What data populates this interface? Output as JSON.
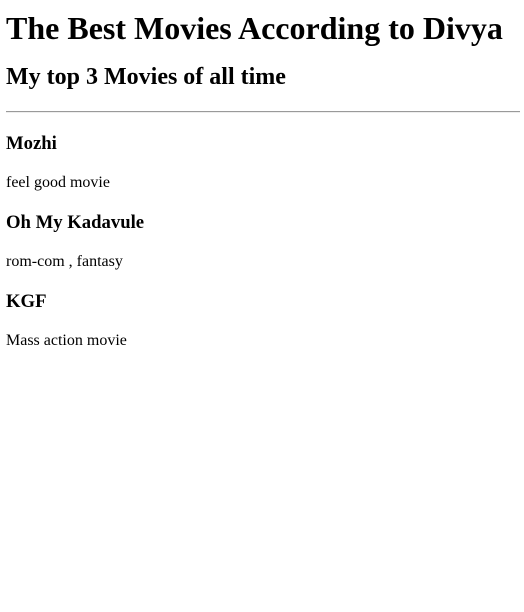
{
  "page": {
    "title": "The Best Movies According to Divya",
    "subtitle": "My top 3 Movies of all time"
  },
  "movies": [
    {
      "name": "Mozhi",
      "description": "feel good movie"
    },
    {
      "name": "Oh My Kadavule",
      "description": "rom-com , fantasy"
    },
    {
      "name": "KGF",
      "description": "Mass action movie"
    }
  ]
}
